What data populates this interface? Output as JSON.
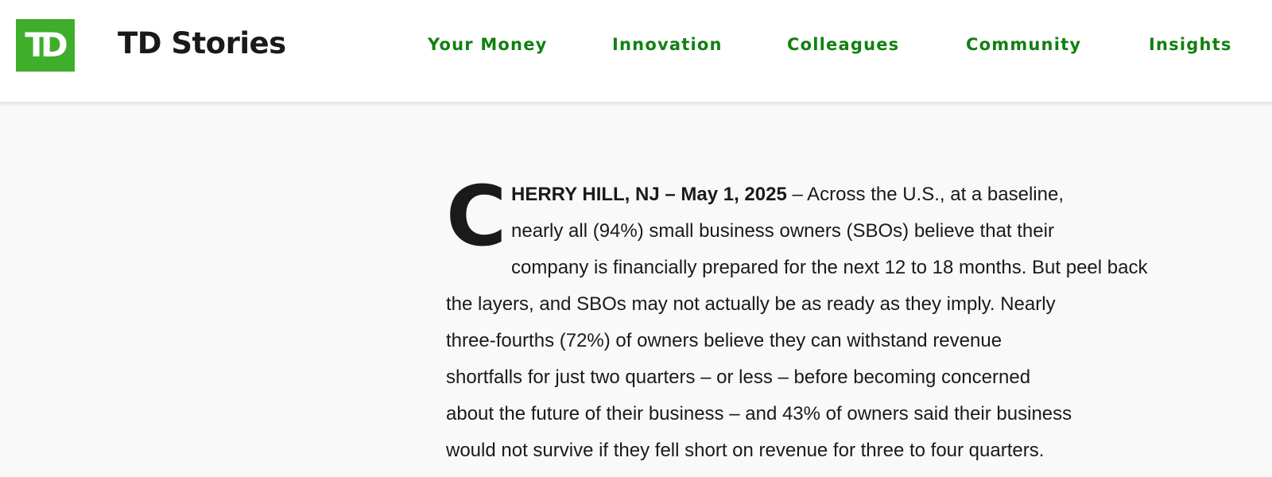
{
  "header": {
    "logo_text": "TD",
    "brand": "TD Stories",
    "nav": {
      "your_money": "Your Money",
      "innovation": "Innovation",
      "colleagues": "Colleagues",
      "community": "Community",
      "insights": "Insights"
    }
  },
  "article": {
    "drop_cap": "C",
    "dateline": "HERRY HILL, NJ – May 1, 2025",
    "lines": [
      " – Across the U.S., at a baseline,",
      "nearly all (94%) small business owners (SBOs) believe that their",
      "company is financially prepared for the next 12 to 18 months. But peel back",
      "the layers, and SBOs may not actually be as ready as they imply. Nearly",
      "three-fourths (72%) of owners believe they can withstand revenue",
      "shortfalls for just two quarters – or less – before becoming concerned",
      "about the future of their business – and 43% of owners said their business",
      "would not survive if they fell short on revenue for three to four quarters."
    ]
  },
  "colors": {
    "brand_green": "#3fae2a",
    "nav_green": "#118011",
    "text": "#1a1a1a",
    "background": "#f9f9f9"
  }
}
